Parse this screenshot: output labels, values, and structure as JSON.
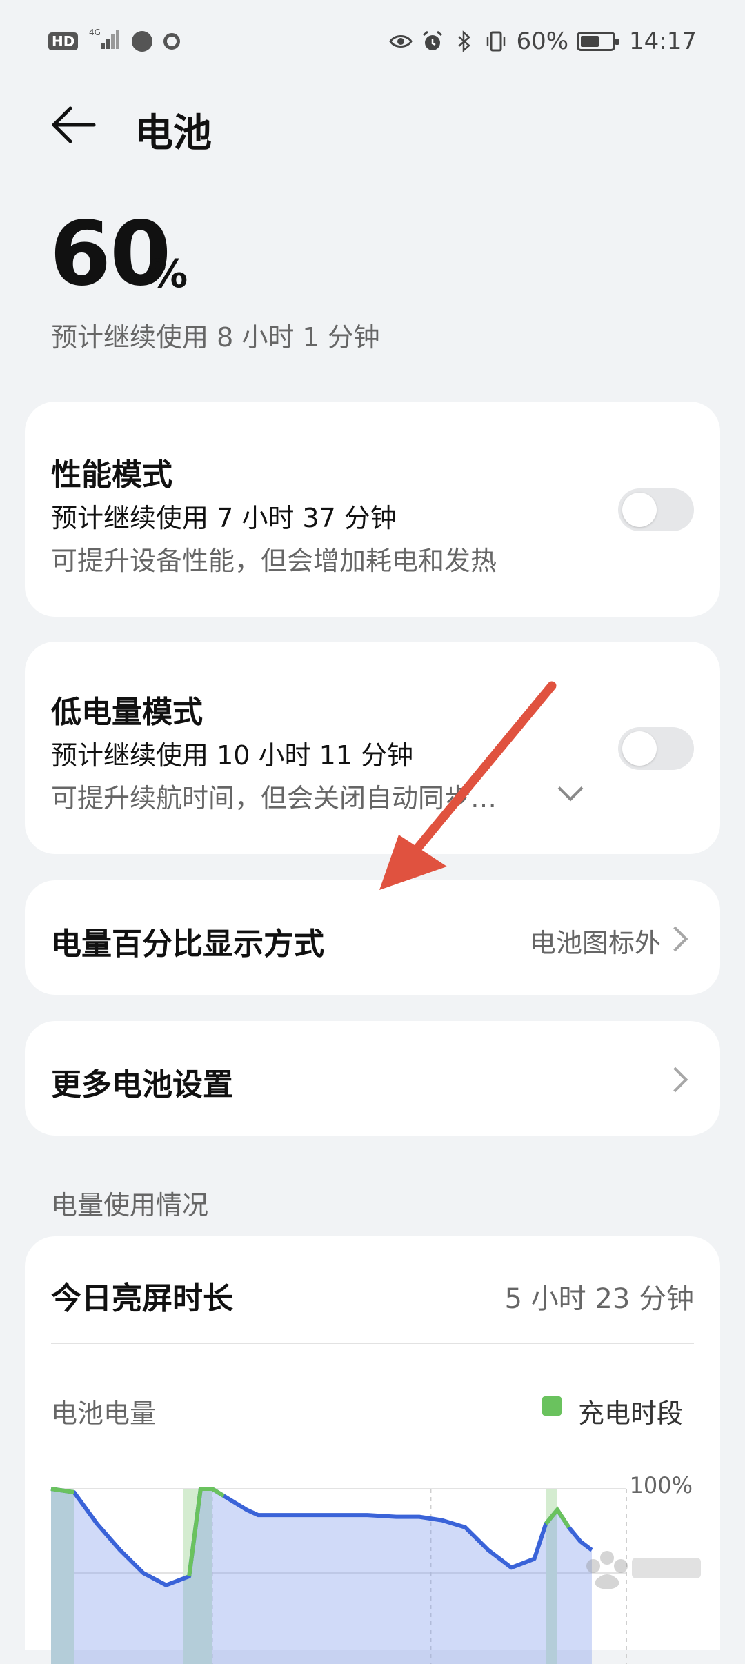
{
  "status_bar": {
    "network_badge": "HD",
    "signal_label": "4G",
    "battery_percent": "60%",
    "time": "14:17",
    "battery_level": 0.6
  },
  "header": {
    "title": "电池"
  },
  "summary": {
    "percent": "60",
    "percent_sign": "%",
    "remaining": "预计继续使用 8 小时 1 分钟"
  },
  "performance_mode": {
    "title": "性能模式",
    "estimate": "预计继续使用 7 小时 37 分钟",
    "description": "可提升设备性能，但会增加耗电和发热",
    "enabled": false
  },
  "low_power_mode": {
    "title": "低电量模式",
    "estimate": "预计继续使用 10 小时 11 分钟",
    "description": "可提升续航时间，但会关闭自动同步…",
    "enabled": false
  },
  "percentage_display": {
    "label": "电量百分比显示方式",
    "value": "电池图标外"
  },
  "more_settings": {
    "label": "更多电池设置"
  },
  "usage": {
    "section_title": "电量使用情况",
    "screen_time_label": "今日亮屏时长",
    "screen_time_value": "5 小时 23 分钟",
    "chart_title": "电池电量",
    "legend_charging": "充电时段",
    "y_top_label": "100%"
  },
  "colors": {
    "accent_blue": "#3a63d8",
    "charging_green": "#6ac25e",
    "annotation_red": "#e0523f"
  },
  "chart_data": {
    "type": "area",
    "title": "电池电量",
    "y_tick_labels": [
      "100%"
    ],
    "ylim": [
      0,
      100
    ],
    "legend": [
      "充电时段"
    ],
    "x": [
      0,
      0.04,
      0.08,
      0.12,
      0.16,
      0.2,
      0.24,
      0.26,
      0.28,
      0.3,
      0.32,
      0.34,
      0.36,
      0.4,
      0.45,
      0.5,
      0.55,
      0.6,
      0.64,
      0.68,
      0.72,
      0.76,
      0.8,
      0.84,
      0.86,
      0.88,
      0.9,
      0.92,
      0.94
    ],
    "values": [
      100,
      98,
      80,
      65,
      52,
      45,
      50,
      100,
      100,
      96,
      92,
      88,
      85,
      85,
      85,
      85,
      85,
      84,
      84,
      82,
      78,
      65,
      55,
      60,
      80,
      88,
      78,
      70,
      65
    ],
    "charging_ranges": [
      [
        0,
        0.04
      ],
      [
        0.23,
        0.28
      ],
      [
        0.86,
        0.88
      ]
    ]
  }
}
